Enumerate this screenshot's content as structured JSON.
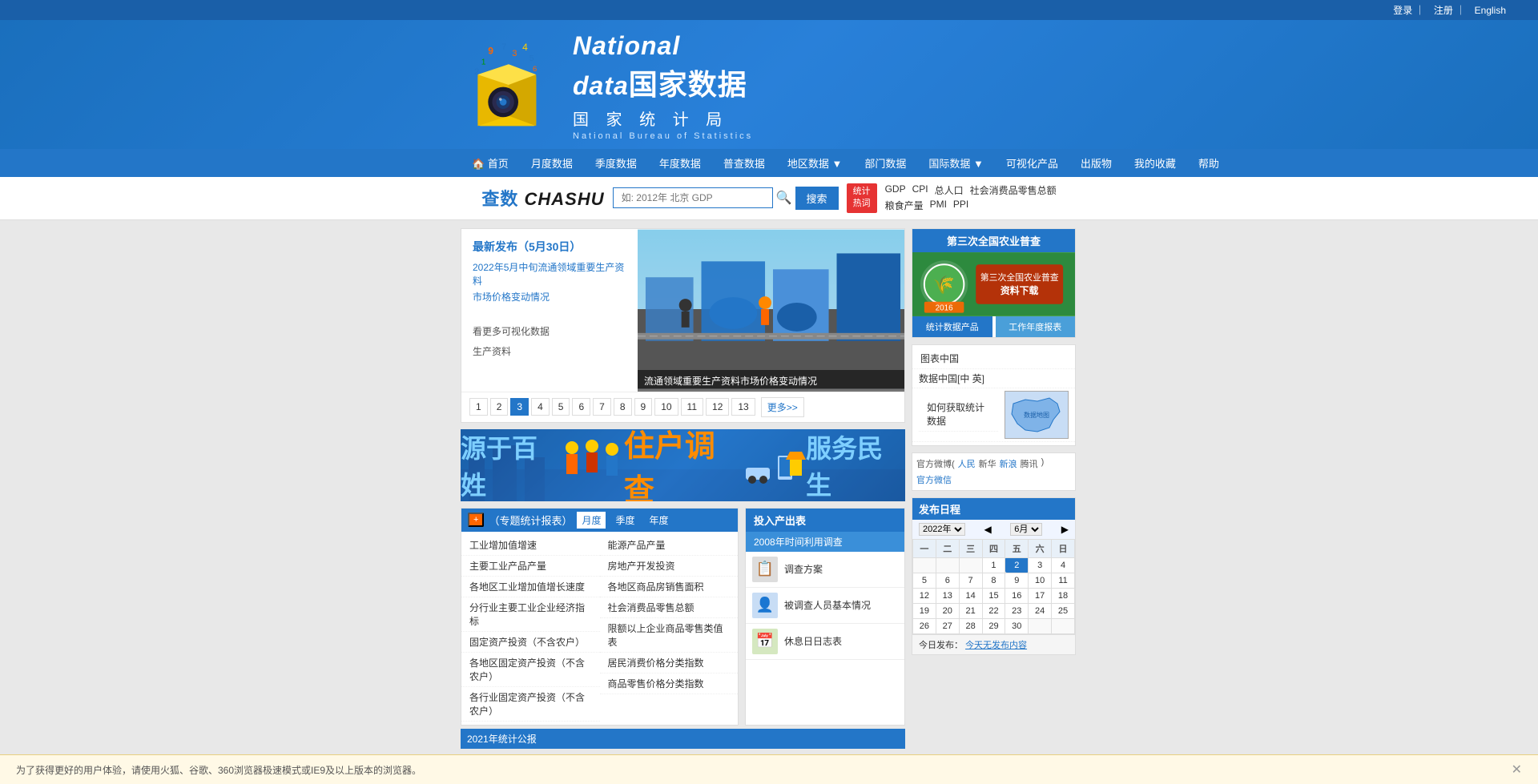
{
  "topbar": {
    "login": "登录",
    "register": "注册",
    "english": "English",
    "sep1": "｜",
    "sep2": "｜"
  },
  "header": {
    "logo_alt": "National Data 国家数据",
    "national_data_en": "National data",
    "national_data_zh": "国家数据",
    "bureau": "国 家 统 计 局",
    "nbs": "National  Bureau  of  Statistics"
  },
  "nav": {
    "items": [
      {
        "label": "🏠 首页",
        "key": "home"
      },
      {
        "label": "月度数据",
        "key": "monthly"
      },
      {
        "label": "季度数据",
        "key": "quarterly"
      },
      {
        "label": "年度数据",
        "key": "annual"
      },
      {
        "label": "普查数据",
        "key": "census"
      },
      {
        "label": "地区数据 ▼",
        "key": "regional"
      },
      {
        "label": "部门数据",
        "key": "dept"
      },
      {
        "label": "国际数据 ▼",
        "key": "intl"
      },
      {
        "label": "可视化产品",
        "key": "visual"
      },
      {
        "label": "出版物",
        "key": "pub"
      },
      {
        "label": "我的收藏",
        "key": "fav"
      },
      {
        "label": "帮助",
        "key": "help"
      }
    ]
  },
  "search": {
    "chashu_label": "查数 CHASHU",
    "placeholder": "如: 2012年 北京 GDP",
    "search_btn": "搜索",
    "hot_btn_line1": "统计",
    "hot_btn_line2": "热词",
    "hot_keywords_row1": [
      "GDP",
      "CPI",
      "总人口",
      "社会消费品零售总额"
    ],
    "hot_keywords_row2": [
      "粮食产量",
      "PMI",
      "PPI"
    ]
  },
  "news": {
    "date_label": "最新发布（5月30日）",
    "links": [
      "2022年5月中旬流通领域重要生产资料",
      "市场价格变动情况",
      "",
      "看更多可视化数据",
      "生产资料"
    ],
    "image_caption": "流通领域重要生产资料市场价格变动情况",
    "pagination": [
      "1",
      "2",
      "3",
      "4",
      "5",
      "6",
      "7",
      "8",
      "9",
      "10",
      "11",
      "12",
      "13"
    ],
    "active_page": "3",
    "more": "更多>>"
  },
  "banner": {
    "text1": "源于百姓",
    "text2": "住户调查",
    "text3": "服务民生"
  },
  "stats_panel": {
    "plus_label": "+",
    "report_label": "（专题统计报表）",
    "tabs": [
      "月度",
      "季度",
      "年度"
    ],
    "active_tab": "月度",
    "items_col1": [
      "工业增加值增速",
      "主要工业产品产量",
      "各地区工业增加值增长速度",
      "分行业主要工业企业经济指标",
      "固定资产投资（不含农户）",
      "各地区固定资产投资（不含农户）",
      "各行业固定资产投资（不含农户）"
    ],
    "items_col2": [
      "能源产品产量",
      "房地产开发投资",
      "各地区商品房销售面积",
      "社会消费品零售总额",
      "限额以上企业商品零售类值表",
      "居民消费价格分类指数",
      "商品零售价格分类指数"
    ]
  },
  "io_panel": {
    "header": "投入产出表",
    "sub_header": "2008年时间利用调查",
    "items": [
      {
        "icon": "📋",
        "label": "调查方案"
      },
      {
        "icon": "👤",
        "label": "被调查人员基本情况"
      },
      {
        "icon": "📅",
        "label": "休息日日志表"
      }
    ]
  },
  "right_sidebar": {
    "agri_title": "第三次全国农业普查",
    "agri_badge_line1": "第三次全国农业普查",
    "agri_badge_line2": "资料下载",
    "agri_year": "2016",
    "product_btns": [
      "统计数据产品",
      "工作年度报表"
    ],
    "links": [
      "图表中国",
      "数据中国[中 英]",
      "如何获取统计数据"
    ],
    "map_label": "数据地图",
    "social_label": "官方微博(人民  新华  新浪  腾讯)  官方微信"
  },
  "calendar": {
    "title": "发布日程",
    "year": "2022年",
    "month": "6月",
    "weekdays": [
      "一",
      "二",
      "三",
      "四",
      "五",
      "六",
      "日"
    ],
    "rows": [
      [
        "",
        "",
        "",
        "1",
        "2",
        "3",
        "4",
        "5"
      ],
      [
        "6",
        "7",
        "8",
        "9",
        "10",
        "11",
        "12"
      ],
      [
        "13",
        "14",
        "15",
        "16",
        "17",
        "18",
        "19"
      ],
      [
        "20",
        "21",
        "22",
        "23",
        "24",
        "25",
        "26"
      ],
      [
        "27",
        "28",
        "29",
        "30",
        "",
        "",
        ""
      ]
    ],
    "today": "2",
    "publish_text": "今日发布：今天无发布内容"
  },
  "notice": {
    "text": "为了获得更好的用户体验，请使用火狐、谷歌、360浏览器极速模式或IE9及以上版本的浏览器。"
  }
}
